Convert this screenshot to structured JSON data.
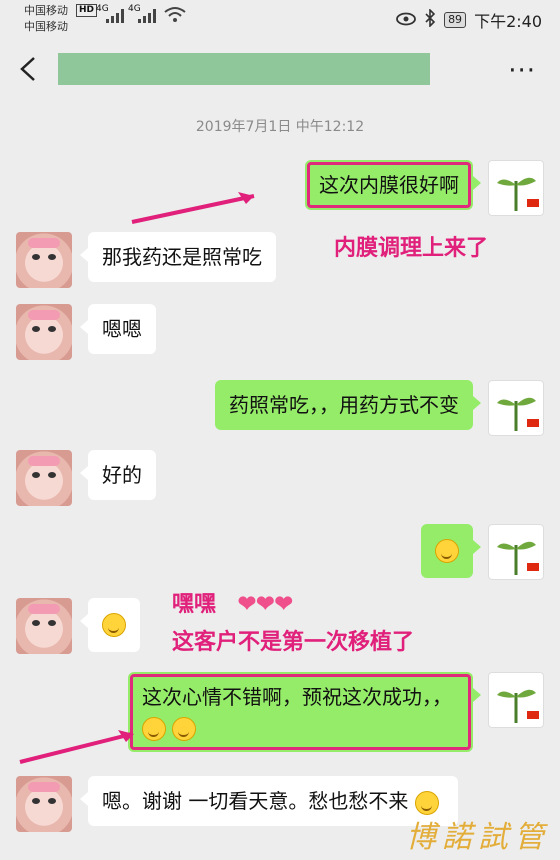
{
  "status_bar": {
    "carrier1": "中国移动",
    "hd": "HD",
    "net1": "4G",
    "net2": "4G",
    "carrier2": "中国移动",
    "battery": "89",
    "time": "下午2:40"
  },
  "chat": {
    "title_redacted": true,
    "more_label": "···",
    "timestamp": "2019年7月1日 中午12:12",
    "messages": [
      {
        "from": "me",
        "text": "这次内膜很好啊"
      },
      {
        "from": "them",
        "text": "那我药还是照常吃"
      },
      {
        "from": "them",
        "text": "嗯嗯"
      },
      {
        "from": "me",
        "text": "药照常吃，，用药方式不变"
      },
      {
        "from": "them",
        "text": "好的"
      },
      {
        "from": "me",
        "emoji": "smile"
      },
      {
        "from": "them",
        "emoji": "grin"
      },
      {
        "from": "me",
        "text": "这次心情不错啊，预祝这次成功，，"
      },
      {
        "from": "them",
        "text": "嗯。谢谢 一切看天意。愁也愁不来"
      }
    ]
  },
  "annotations": {
    "note1": "内膜调理上来了",
    "note2_line1": "嘿嘿",
    "note2_line2": "这客户不是第一次移植了"
  },
  "watermark": "博諾試管",
  "colors": {
    "accent": "#e0207a",
    "outgoing_bubble": "#95ec69",
    "incoming_bubble": "#ffffff",
    "background": "#ededed"
  }
}
